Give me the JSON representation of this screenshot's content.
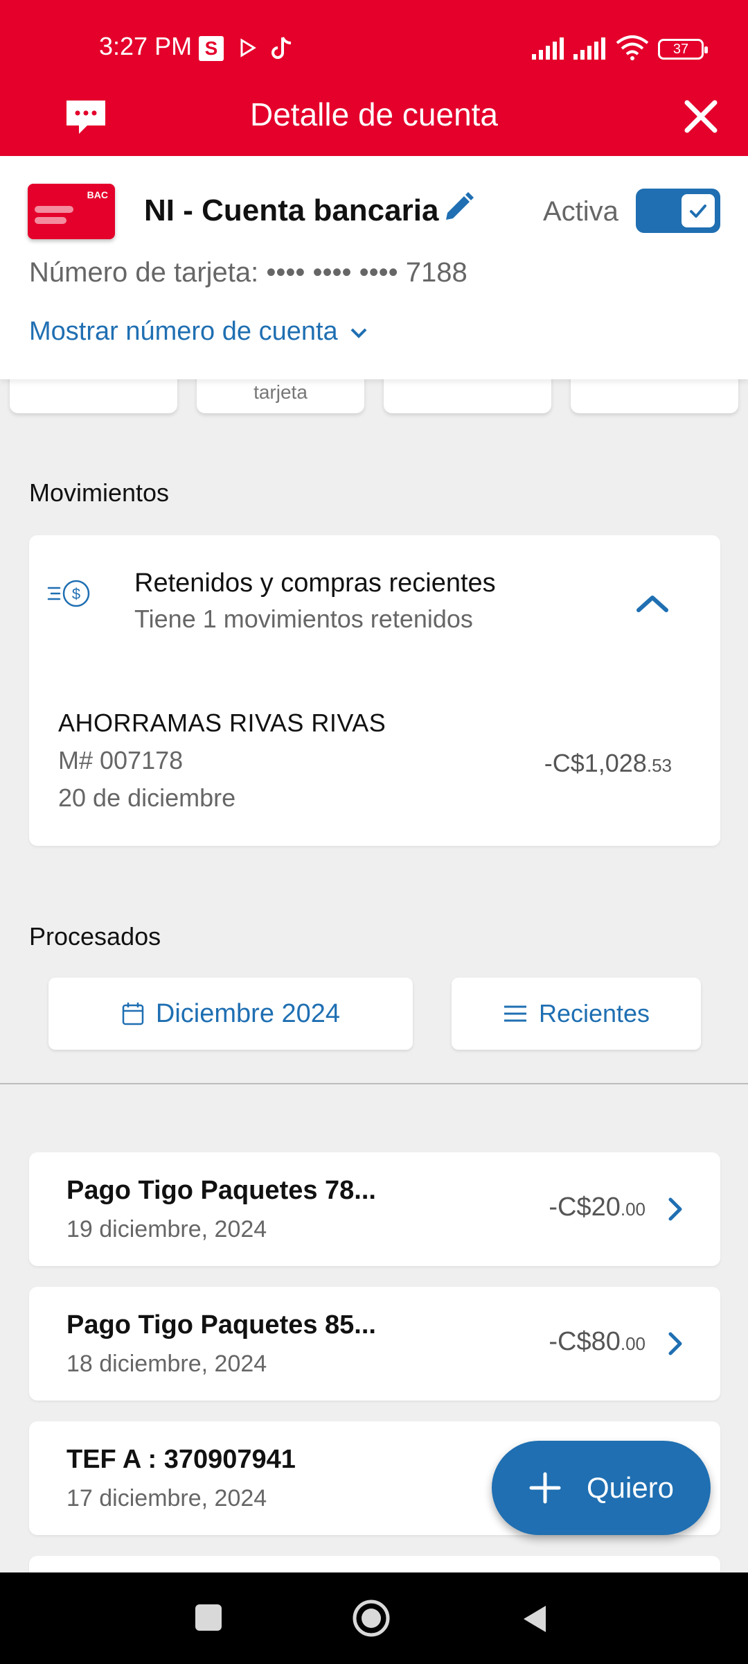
{
  "status_bar": {
    "time": "3:27 PM",
    "s_badge": "S",
    "battery": "37"
  },
  "header": {
    "title": "Detalle de cuenta"
  },
  "account": {
    "name": "NI - Cuenta bancaria",
    "card_logo": "BAC",
    "active_label": "Activa",
    "active": true,
    "card_number": "Número de tarjeta: •••• •••• •••• 7188",
    "show_account_link": "Mostrar número de cuenta"
  },
  "quick_actions": [
    {
      "label": ""
    },
    {
      "label": "tarjeta"
    },
    {
      "label": ""
    },
    {
      "label": ""
    }
  ],
  "movements": {
    "section_title": "Movimientos",
    "pending": {
      "title": "Retenidos y compras recientes",
      "subtitle": "Tiene  1  movimientos retenidos",
      "item": {
        "merchant": "AHORRAMAS RIVAS RIVAS",
        "reference": "M# 007178",
        "date": "20 de diciembre",
        "amount": "-C$1,028",
        "cents": ".53"
      }
    }
  },
  "processed": {
    "section_title": "Procesados",
    "month_filter": "Diciembre 2024",
    "sort_filter": "Recientes",
    "transactions": [
      {
        "title": "Pago Tigo Paquetes 78...",
        "date": "19 diciembre, 2024",
        "amount": "-C$20",
        "cents": ".00"
      },
      {
        "title": "Pago Tigo Paquetes 85...",
        "date": "18 diciembre, 2024",
        "amount": "-C$80",
        "cents": ".00"
      },
      {
        "title": "TEF A : 370907941",
        "date": "17 diciembre, 2024",
        "amount": "",
        "cents": ""
      }
    ]
  },
  "fab": {
    "label": "Quiero"
  },
  "colors": {
    "brand_red": "#e4002b",
    "accent_blue": "#1f6fb2",
    "background": "#efefef"
  },
  "icons": {
    "chat": "chat-bubble-icon",
    "close": "close-icon",
    "edit": "pencil-icon",
    "hold": "money-hold-icon",
    "calendar": "calendar-icon",
    "sort": "list-icon",
    "plus": "plus-icon"
  }
}
